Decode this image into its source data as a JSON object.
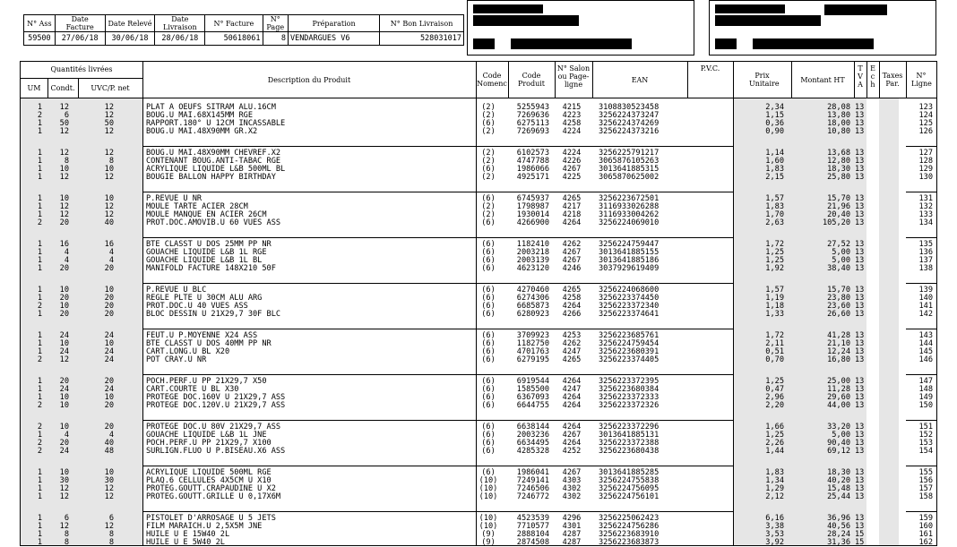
{
  "header": {
    "labels": [
      "N° Ass",
      "Date Facture",
      "Date Relevé",
      "Date Livraison",
      "N° Facture",
      "N° Page",
      "Préparation",
      "N° Bon Livraison"
    ],
    "values": [
      "59500",
      "27/06/18",
      "30/06/18",
      "28/06/18",
      "50618061",
      "8",
      "VENDARGUES V6",
      "528031017"
    ]
  },
  "columns": {
    "qty_group": "Quantités livrées",
    "um": "UM",
    "condt": "Condt.",
    "uvc": "UVC/P. net",
    "desc": "Description du Produit",
    "nomenc": "Code Nomenc",
    "code": "Code Produit",
    "salon": "N° Salon ou Page-ligne",
    "ean": "EAN",
    "pvc": "P.V.C.",
    "prix": "Prix Unitaire",
    "montant": "Montant HT",
    "tva": "T V A",
    "ech": "E c h",
    "taxes": "Taxes Par.",
    "ligne": "N° Ligne"
  },
  "groups": [
    [
      [
        "1",
        "12",
        "12",
        "PLAT A OEUFS SITRAM ALU.16CM",
        "(2)",
        "5255943",
        "4215",
        "3108830523458",
        "2,34",
        "28,08",
        "13",
        "123"
      ],
      [
        "2",
        "6",
        "12",
        "BOUG.U MAI.68X145MM RGE",
        "(2)",
        "7269636",
        "4223",
        "3256224373247",
        "1,15",
        "13,80",
        "13",
        "124"
      ],
      [
        "1",
        "50",
        "50",
        "RAPPORT.180° U 12CM INCASSABLE",
        "(6)",
        "6275113",
        "4258",
        "3256224374269",
        "0,36",
        "18,00",
        "13",
        "125"
      ],
      [
        "1",
        "12",
        "12",
        "BOUG.U MAI.48X90MM GR.X2",
        "(2)",
        "7269693",
        "4224",
        "3256224373216",
        "0,90",
        "10,80",
        "13",
        "126"
      ]
    ],
    [
      [
        "1",
        "12",
        "12",
        "BOUG.U MAI.48X90MM CHEVREF.X2",
        "(2)",
        "6102573",
        "4224",
        "3256225791217",
        "1,14",
        "13,68",
        "13",
        "127"
      ],
      [
        "1",
        "8",
        "8",
        "CONTENANT BOUG.ANTI-TABAC RGE",
        "(2)",
        "4747788",
        "4226",
        "3065876105263",
        "1,60",
        "12,80",
        "13",
        "128"
      ],
      [
        "1",
        "10",
        "10",
        "ACRYLIQUE LIQUIDE L&B 500ML BL",
        "(6)",
        "1986066",
        "4267",
        "3013641885315",
        "1,83",
        "18,30",
        "13",
        "129"
      ],
      [
        "1",
        "12",
        "12",
        "BOUGIE BALLON HAPPY BIRTHDAY",
        "(2)",
        "4925171",
        "4225",
        "3065870625002",
        "2,15",
        "25,80",
        "13",
        "130"
      ]
    ],
    [
      [
        "1",
        "10",
        "10",
        "P.REVUE U NR",
        "(6)",
        "6745937",
        "4265",
        "3256223672501",
        "1,57",
        "15,70",
        "13",
        "131"
      ],
      [
        "1",
        "12",
        "12",
        "MOULE TARTE ACIER 28CM",
        "(2)",
        "1798987",
        "4217",
        "3116933026288",
        "1,83",
        "21,96",
        "13",
        "132"
      ],
      [
        "1",
        "12",
        "12",
        "MOULE MANQUE EN ACIER 26CM",
        "(2)",
        "1930014",
        "4218",
        "3116933004262",
        "1,70",
        "20,40",
        "13",
        "133"
      ],
      [
        "2",
        "20",
        "40",
        "PROT.DOC.AMOVIB.U 60 VUES ASS",
        "(6)",
        "4266900",
        "4264",
        "3256224069010",
        "2,63",
        "105,20",
        "13",
        "134"
      ]
    ],
    [
      [
        "1",
        "16",
        "16",
        "BTE CLASST U DOS 25MM PP NR",
        "(6)",
        "1182410",
        "4262",
        "3256224759447",
        "1,72",
        "27,52",
        "13",
        "135"
      ],
      [
        "1",
        "4",
        "4",
        "GOUACHE LIQUIDE L&B 1L RGE",
        "(6)",
        "2003218",
        "4267",
        "3013641885155",
        "1,25",
        "5,00",
        "13",
        "136"
      ],
      [
        "1",
        "4",
        "4",
        "GOUACHE LIQUIDE L&B 1L BL",
        "(6)",
        "2003139",
        "4267",
        "3013641885186",
        "1,25",
        "5,00",
        "13",
        "137"
      ],
      [
        "1",
        "20",
        "20",
        "MANIFOLD FACTURE 148X210 50F",
        "(6)",
        "4623120",
        "4246",
        "3037929619409",
        "1,92",
        "38,40",
        "13",
        "138"
      ]
    ],
    [
      [
        "1",
        "10",
        "10",
        "P.REVUE U BLC",
        "(6)",
        "4270460",
        "4265",
        "3256224068600",
        "1,57",
        "15,70",
        "13",
        "139"
      ],
      [
        "1",
        "20",
        "20",
        "REGLE PLTE U 30CM ALU ARG",
        "(6)",
        "6274306",
        "4258",
        "3256223374450",
        "1,19",
        "23,80",
        "13",
        "140"
      ],
      [
        "2",
        "10",
        "20",
        "PROT.DOC.U 40 VUES ASS",
        "(6)",
        "6685873",
        "4264",
        "3256223372340",
        "1,18",
        "23,60",
        "13",
        "141"
      ],
      [
        "1",
        "20",
        "20",
        "BLOC DESSIN U 21X29,7 30F BLC",
        "(6)",
        "6280923",
        "4266",
        "3256223374641",
        "1,33",
        "26,60",
        "13",
        "142"
      ]
    ],
    [
      [
        "1",
        "24",
        "24",
        "FEUT.U P.MOYENNE X24 ASS",
        "(6)",
        "3709923",
        "4253",
        "3256223685761",
        "1,72",
        "41,28",
        "13",
        "143"
      ],
      [
        "1",
        "10",
        "10",
        "BTE CLASST U DOS 40MM PP NR",
        "(6)",
        "1182750",
        "4262",
        "3256224759454",
        "2,11",
        "21,10",
        "13",
        "144"
      ],
      [
        "1",
        "24",
        "24",
        "CART.LONG.U BL X20",
        "(6)",
        "4701763",
        "4247",
        "3256223680391",
        "0,51",
        "12,24",
        "13",
        "145"
      ],
      [
        "2",
        "12",
        "24",
        "POT CRAY.U NR",
        "(6)",
        "6279195",
        "4265",
        "3256223374405",
        "0,70",
        "16,80",
        "13",
        "146"
      ]
    ],
    [
      [
        "1",
        "20",
        "20",
        "POCH.PERF.U PP 21X29,7 X50",
        "(6)",
        "6919544",
        "4264",
        "3256223372395",
        "1,25",
        "25,00",
        "13",
        "147"
      ],
      [
        "1",
        "24",
        "24",
        "CART.COURTE U BL X30",
        "(6)",
        "1585500",
        "4247",
        "3256223680384",
        "0,47",
        "11,28",
        "13",
        "148"
      ],
      [
        "1",
        "10",
        "10",
        "PROTEGE DOC.160V U 21X29,7 ASS",
        "(6)",
        "6367093",
        "4264",
        "3256223372333",
        "2,96",
        "29,60",
        "13",
        "149"
      ],
      [
        "2",
        "10",
        "20",
        "PROTEGE DOC.120V.U 21X29,7 ASS",
        "(6)",
        "6644755",
        "4264",
        "3256223372326",
        "2,20",
        "44,00",
        "13",
        "150"
      ]
    ],
    [
      [
        "2",
        "10",
        "20",
        "PROTEGE DOC.U 80V 21X29,7 ASS",
        "(6)",
        "6638144",
        "4264",
        "3256223372296",
        "1,66",
        "33,20",
        "13",
        "151"
      ],
      [
        "1",
        "4",
        "4",
        "GOUACHE LIQUIDE L&B 1L JNE",
        "(6)",
        "2003236",
        "4267",
        "3013641885131",
        "1,25",
        "5,00",
        "13",
        "152"
      ],
      [
        "2",
        "20",
        "40",
        "POCH.PERF.U PP 21X29,7 X100",
        "(6)",
        "6634495",
        "4264",
        "3256223372388",
        "2,26",
        "90,40",
        "13",
        "153"
      ],
      [
        "2",
        "24",
        "48",
        "SURLIGN.FLUO U P.BISEAU.X6 ASS",
        "(6)",
        "4285328",
        "4252",
        "3256223680438",
        "1,44",
        "69,12",
        "13",
        "154"
      ]
    ],
    [
      [
        "1",
        "10",
        "10",
        "ACRYLIQUE LIQUIDE 500ML RGE",
        "(6)",
        "1986041",
        "4267",
        "3013641885285",
        "1,83",
        "18,30",
        "13",
        "155"
      ],
      [
        "1",
        "30",
        "30",
        "PLAQ.6 CELLULES 4X5CM U X10",
        "(10)",
        "7249141",
        "4303",
        "3256224755838",
        "1,34",
        "40,20",
        "13",
        "156"
      ],
      [
        "1",
        "12",
        "12",
        "PROTEG.GOUTT.CRAPAUDINE U X2",
        "(10)",
        "7246506",
        "4302",
        "3256224756095",
        "1,29",
        "15,48",
        "13",
        "157"
      ],
      [
        "1",
        "12",
        "12",
        "PROTEG.GOUTT.GRILLE U 0,17X6M",
        "(10)",
        "7246772",
        "4302",
        "3256224756101",
        "2,12",
        "25,44",
        "13",
        "158"
      ]
    ],
    [
      [
        "1",
        "6",
        "6",
        "PISTOLET D'ARROSAGE U 5 JETS",
        "(10)",
        "4523539",
        "4296",
        "3256225062423",
        "6,16",
        "36,96",
        "13",
        "159"
      ],
      [
        "1",
        "12",
        "12",
        "FILM MARAICH.U 2,5X5M JNE",
        "(10)",
        "7710577",
        "4301",
        "3256224756286",
        "3,38",
        "40,56",
        "13",
        "160"
      ],
      [
        "1",
        "8",
        "8",
        "HUILE U E 15W40 2L",
        "(9)",
        "2888104",
        "4287",
        "3256223683910",
        "3,53",
        "28,24",
        "15",
        "161"
      ],
      [
        "1",
        "8",
        "8",
        "HUILE U E 5W40 2L",
        "(9)",
        "2874508",
        "4287",
        "3256223683873",
        "3,92",
        "31,36",
        "15",
        "162"
      ]
    ]
  ]
}
